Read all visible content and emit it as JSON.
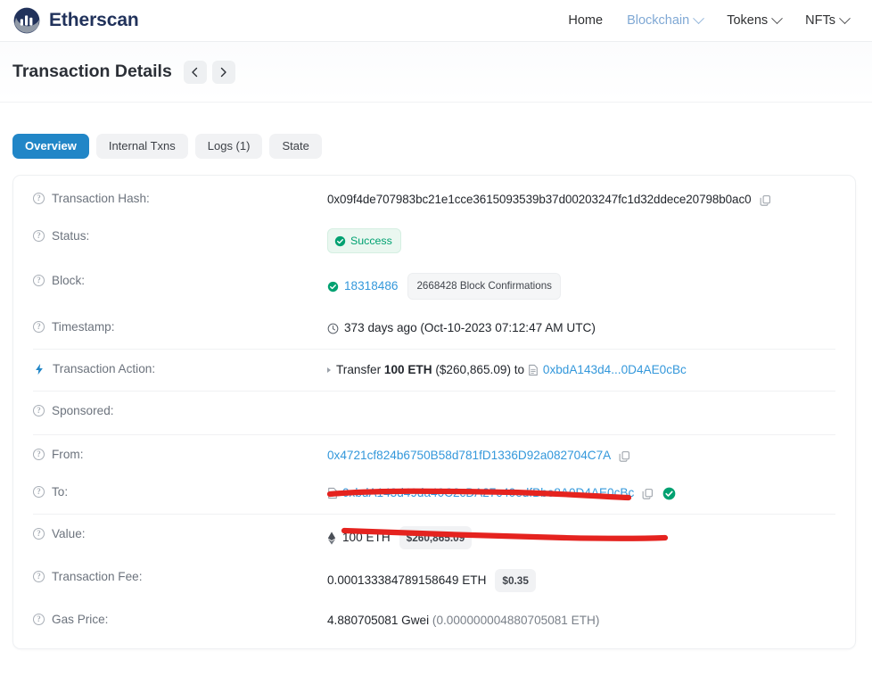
{
  "header": {
    "brand": "Etherscan",
    "nav": [
      {
        "label": "Home",
        "has_chevron": false,
        "active": false
      },
      {
        "label": "Blockchain",
        "has_chevron": true,
        "active": true
      },
      {
        "label": "Tokens",
        "has_chevron": true,
        "active": false
      },
      {
        "label": "NFTs",
        "has_chevron": true,
        "active": false
      }
    ]
  },
  "titlebar": {
    "title": "Transaction Details",
    "prev_icon": "chevron-left-icon",
    "next_icon": "chevron-right-icon"
  },
  "tabs": [
    {
      "label": "Overview",
      "active": true
    },
    {
      "label": "Internal Txns",
      "active": false
    },
    {
      "label": "Logs (1)",
      "active": false
    },
    {
      "label": "State",
      "active": false
    }
  ],
  "details": {
    "transaction_hash": {
      "label": "Transaction Hash:",
      "value": "0x09f4de707983bc21e1cce3615093539b37d00203247fc1d32ddece20798b0ac0"
    },
    "status": {
      "label": "Status:",
      "value": "Success"
    },
    "block": {
      "label": "Block:",
      "number": "18318486",
      "confirmations": "2668428 Block Confirmations"
    },
    "timestamp": {
      "label": "Timestamp:",
      "value": "373 days ago (Oct-10-2023 07:12:47 AM UTC)"
    },
    "transaction_action": {
      "label": "Transaction Action:",
      "prefix": "Transfer",
      "amount": "100 ETH",
      "usd": "($260,865.09)",
      "to_word": "to",
      "address_short": "0xbdA143d4...0D4AE0cBc"
    },
    "sponsored": {
      "label": "Sponsored:",
      "value": ""
    },
    "from": {
      "label": "From:",
      "address": "0x4721cf824b6750B58d781fD1336D92a082704C7A"
    },
    "to": {
      "label": "To:",
      "address": "0xbdA143d49da40C2cDA27c40edfBbe8A0D4AE0cBc"
    },
    "value": {
      "label": "Value:",
      "eth": "100 ETH",
      "usd": "$260,865.09"
    },
    "transaction_fee": {
      "label": "Transaction Fee:",
      "eth": "0.000133384789158649 ETH",
      "usd": "$0.35"
    },
    "gas_price": {
      "label": "Gas Price:",
      "gwei": "4.880705081 Gwei",
      "eth": "(0.000000004880705081 ETH)"
    }
  },
  "colors": {
    "brand_navy": "#21325b",
    "accent_blue": "#2186c7",
    "link_blue": "#3498db",
    "success_green": "#00a171",
    "annotation_red": "#e5231f"
  }
}
